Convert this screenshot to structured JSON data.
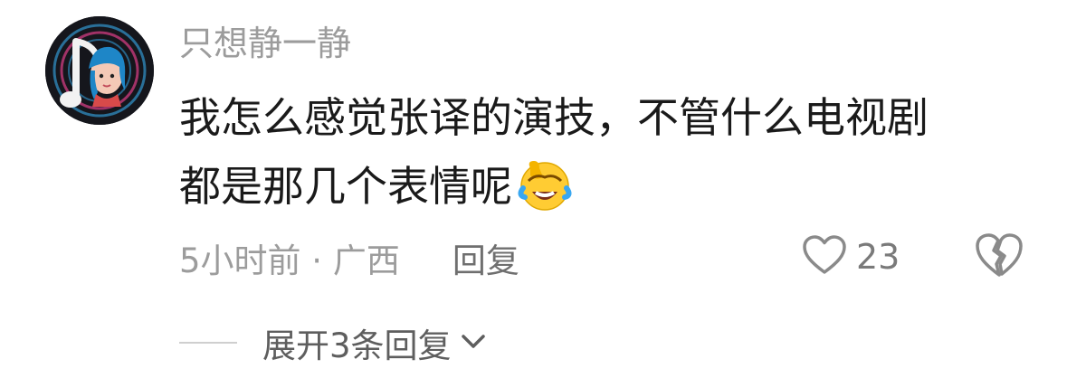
{
  "comment": {
    "username": "只想静一静",
    "text_line1": "我怎么感觉张译的演技，不管什么电视剧",
    "text_line2": "都是那几个表情呢",
    "emoji": "rolling-on-floor-laughing-emoji",
    "time_location": "5小时前 · 广西",
    "reply_label": "回复",
    "like_count": "23",
    "expand_replies_label": "展开3条回复"
  },
  "colors": {
    "username": "#9c9c9c",
    "body_text": "#1a1a1a",
    "meta_text": "#9c9c9c",
    "icon_stroke": "#8a8a8a",
    "avatar_bg": "#15161c"
  }
}
